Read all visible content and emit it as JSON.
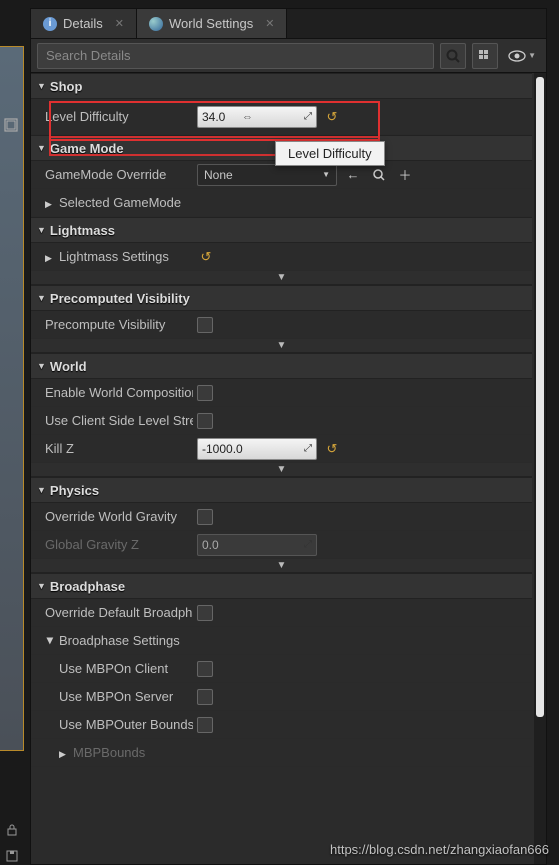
{
  "tabs": {
    "details": {
      "label": "Details"
    },
    "world": {
      "label": "World Settings"
    }
  },
  "search": {
    "placeholder": "Search Details"
  },
  "tooltip": {
    "text": "Level Difficulty"
  },
  "sections": {
    "shop": {
      "title": "Shop",
      "levelDifficulty": {
        "label": "Level Difficulty",
        "value": "34.0"
      }
    },
    "gameMode": {
      "title": "Game Mode",
      "override": {
        "label": "GameMode Override",
        "value": "None"
      },
      "selected": {
        "label": "Selected GameMode"
      }
    },
    "lightmass": {
      "title": "Lightmass",
      "settings": {
        "label": "Lightmass Settings"
      }
    },
    "precomp": {
      "title": "Precomputed Visibility",
      "precompute": {
        "label": "Precompute Visibility"
      }
    },
    "world": {
      "title": "World",
      "enableComp": {
        "label": "Enable World Composition"
      },
      "clientSide": {
        "label": "Use Client Side Level Streaming"
      },
      "killZ": {
        "label": "Kill Z",
        "value": "-1000.0"
      }
    },
    "physics": {
      "title": "Physics",
      "overrideGrav": {
        "label": "Override World Gravity"
      },
      "globalGrav": {
        "label": "Global Gravity Z",
        "value": "0.0"
      }
    },
    "broadphase": {
      "title": "Broadphase",
      "overrideDef": {
        "label": "Override Default Broadphase"
      },
      "settings": {
        "label": "Broadphase Settings"
      },
      "mbpClient": {
        "label": "Use MBPOn Client"
      },
      "mbpServer": {
        "label": "Use MBPOn Server"
      },
      "mbpOuter": {
        "label": "Use MBPOuter Bounds"
      },
      "mbpBounds": {
        "label": "MBPBounds"
      }
    }
  },
  "watermark": "https://blog.csdn.net/zhangxiaofan666"
}
